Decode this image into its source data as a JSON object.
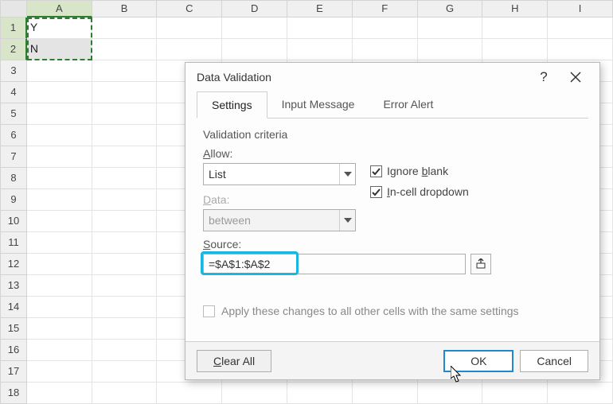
{
  "columns": [
    "A",
    "B",
    "C",
    "D",
    "E",
    "F",
    "G",
    "H",
    "I"
  ],
  "rows": [
    "1",
    "2",
    "3",
    "4",
    "5",
    "6",
    "7",
    "8",
    "9",
    "10",
    "11",
    "12",
    "13",
    "14",
    "15",
    "16",
    "17",
    "18"
  ],
  "cells": {
    "A1": "Y",
    "A2": "N"
  },
  "dialog": {
    "title": "Data Validation",
    "tabs": {
      "settings": "Settings",
      "input": "Input Message",
      "error": "Error Alert"
    },
    "criteria_label": "Validation criteria",
    "allow_label": "Allow:",
    "allow_value": "List",
    "data_label": "Data:",
    "data_value": "between",
    "source_label": "Source:",
    "source_value": "=$A$1:$A$2",
    "ignore_blank": "Ignore blank",
    "incell_dropdown": "In-cell dropdown",
    "apply_all": "Apply these changes to all other cells with the same settings"
  },
  "buttons": {
    "clear_all": "Clear All",
    "ok": "OK",
    "cancel": "Cancel"
  }
}
